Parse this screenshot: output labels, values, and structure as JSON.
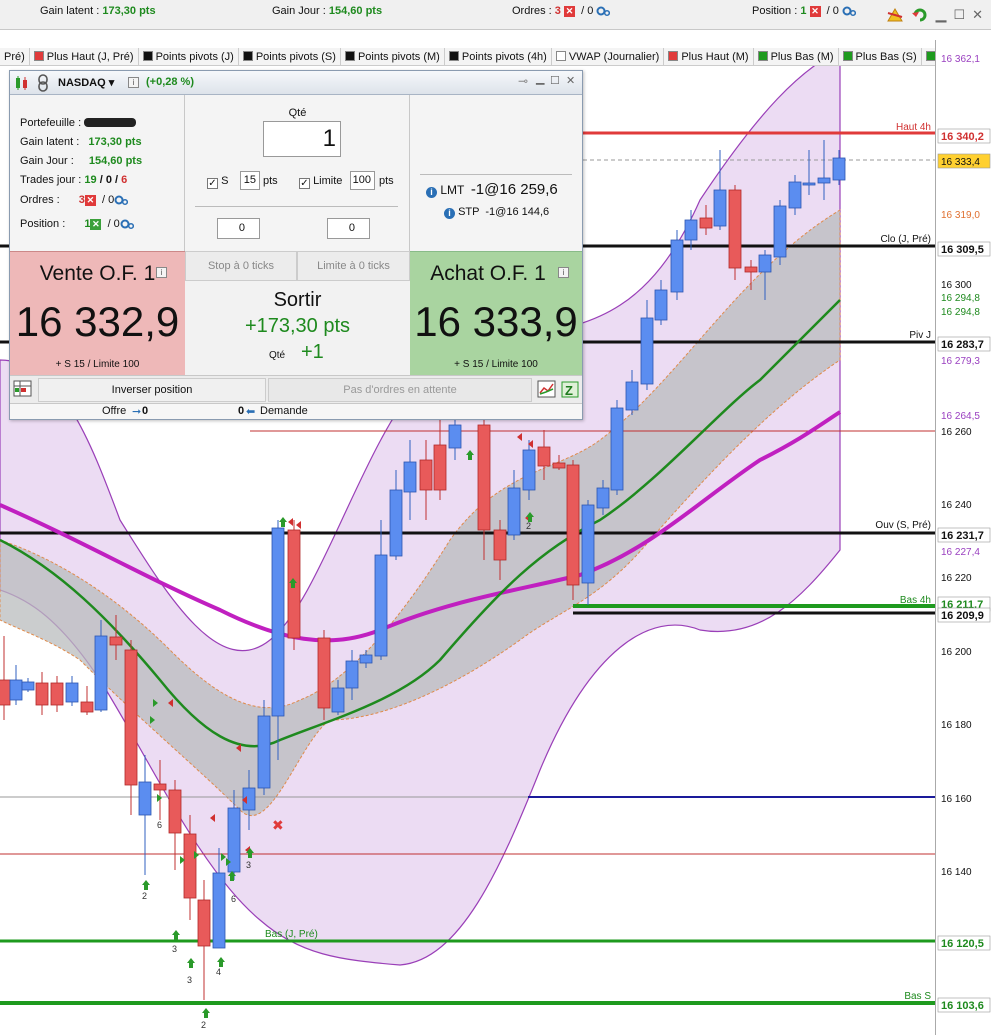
{
  "topbar": {
    "gain_latent_label": "Gain latent :",
    "gain_latent_value": "173,30 pts",
    "gain_jour_label": "Gain Jour :",
    "gain_jour_value": "154,60 pts",
    "ordres_label": "Ordres :",
    "ordres_count": "3",
    "ordres_zero": "/ 0",
    "position_label": "Position :",
    "position_count": "1",
    "position_zero": "/ 0"
  },
  "legend": [
    {
      "label": "Pré)",
      "color": ""
    },
    {
      "label": "Plus Haut (J, Pré)",
      "color": "#e03a3a"
    },
    {
      "label": "Points pivots (J)",
      "color": "#111111"
    },
    {
      "label": "Points pivots (S)",
      "color": "#111111"
    },
    {
      "label": "Points pivots (M)",
      "color": "#111111"
    },
    {
      "label": "Points pivots (4h)",
      "color": "#111111"
    },
    {
      "label": "VWAP (Journalier)",
      "color": "#ffffff"
    },
    {
      "label": "Plus Haut (M)",
      "color": "#e03a3a"
    },
    {
      "label": "Plus Bas (M)",
      "color": "#1e9a1e"
    },
    {
      "label": "Plus Bas (S)",
      "color": "#1e9a1e"
    },
    {
      "label": "Plus Ba",
      "color": "#1e9a1e"
    }
  ],
  "panel": {
    "instrument": "NASDAQ",
    "change": "(+0,28 %)",
    "portefeuille_label": "Portefeuille :",
    "gain_latent_label": "Gain latent :",
    "gain_latent_value": "173,30 pts",
    "gain_jour_label": "Gain Jour :",
    "gain_jour_value": "154,60 pts",
    "trades_label": "Trades jour :",
    "trades_a": "19",
    "trades_b": "0",
    "trades_c": "6",
    "ordres_label": "Ordres :",
    "ordres_count": "3",
    "ordres_zero": "/ 0",
    "position_label": "Position :",
    "position_count": "1",
    "position_zero": "/ 0",
    "qte_label": "Qté",
    "qte_value": "1",
    "s_label": "S",
    "s_value": "15",
    "pts": "pts",
    "limite_label": "Limite",
    "limite_value": "100",
    "spin_left": "0",
    "spin_right": "0",
    "lmt_label": "LMT",
    "lmt_value": "-1@16 259,6",
    "stp_label": "STP",
    "stp_value": "-1@16 144,6",
    "stop_btn": "Stop à 0 ticks",
    "limit_btn": "Limite à 0 ticks",
    "sell_title": "Vente O.F. 1",
    "sell_price": "16 332,9",
    "sell_sub": "+ S 15 / Limite 100",
    "buy_title": "Achat O.F. 1",
    "buy_price": "16 333,9",
    "buy_sub": "+ S 15 / Limite 100",
    "exit_title": "Sortir",
    "exit_pnl": "+173,30 pts",
    "exit_qte_label": "Qté",
    "exit_qte": "+1",
    "inverser": "Inverser position",
    "pas_ordres": "Pas d'ordres en attente",
    "offre_label": "Offre",
    "offre_value": "0",
    "demande_value": "0",
    "demande_label": "Demande"
  },
  "chart": {
    "levels": [
      {
        "name": "Haut 4h",
        "price": "16 340,2"
      },
      {
        "name": "Clo (J, Pré)",
        "price": "16 309,5"
      },
      {
        "name": "Piv J",
        "price": "16 283,7"
      },
      {
        "name": "Ouv (S, Pré)",
        "price": "16 231,7"
      },
      {
        "name": "Bas 4h",
        "price": "16 211,7"
      },
      {
        "name": "",
        "price": "16 209,9"
      },
      {
        "name": "Bas (J, Pré)",
        "price": "16 120,5"
      },
      {
        "name": "Bas S",
        "price": "16 103,6"
      }
    ],
    "axis_labels": [
      {
        "text": "16 362,1",
        "color": "#9a40c0"
      },
      {
        "text": "16 340,2",
        "color": "#d03030"
      },
      {
        "text": "16 333,4",
        "color": "#111111"
      },
      {
        "text": "16 319,0",
        "color": "#e07030"
      },
      {
        "text": "16 309,5",
        "color": "#111111"
      },
      {
        "text": "16 300",
        "color": "#111111"
      },
      {
        "text": "16 294,8",
        "color": "#1e8a1e"
      },
      {
        "text": "16 294,8",
        "color": "#1e8a1e"
      },
      {
        "text": "16 283,7",
        "color": "#111111"
      },
      {
        "text": "16 279,3",
        "color": "#9a40c0"
      },
      {
        "text": "16 264,5",
        "color": "#9a40c0"
      },
      {
        "text": "16 260",
        "color": "#111111"
      },
      {
        "text": "16 240",
        "color": "#111111"
      },
      {
        "text": "16 231,7",
        "color": "#111111"
      },
      {
        "text": "16 227,4",
        "color": "#9a40c0"
      },
      {
        "text": "16 220",
        "color": "#111111"
      },
      {
        "text": "16 211,7",
        "color": "#1e8a1e"
      },
      {
        "text": "16 209,9",
        "color": "#111111"
      },
      {
        "text": "16 200",
        "color": "#111111"
      },
      {
        "text": "16 180",
        "color": "#111111"
      },
      {
        "text": "16 160",
        "color": "#111111"
      },
      {
        "text": "16 140",
        "color": "#111111"
      },
      {
        "text": "16 120,5",
        "color": "#1e8a1e"
      },
      {
        "text": "16 103,6",
        "color": "#1e8a1e"
      }
    ],
    "trade_counts": [
      "2",
      "6",
      "3",
      "3",
      "4",
      "2",
      "6",
      "3",
      "2"
    ]
  }
}
